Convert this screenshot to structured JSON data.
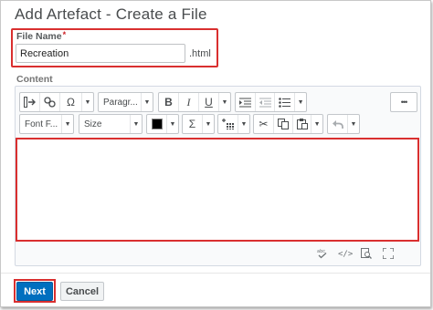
{
  "dialog": {
    "title": "Add Artefact - Create a File"
  },
  "file_name": {
    "label": "File Name",
    "required_marker": "*",
    "value": "Recreation",
    "suffix": ".html"
  },
  "content": {
    "label": "Content"
  },
  "toolbar": {
    "paragraph_select": "Paragr...",
    "font_family_select": "Font F...",
    "size_select": "Size",
    "bold": "B",
    "italic": "I",
    "underline": "U",
    "more": "•••",
    "sigma": "Σ",
    "text_color": "#000000"
  },
  "actions": {
    "next_label": "Next",
    "cancel_label": "Cancel"
  },
  "colors": {
    "primary": "#006fbf",
    "highlight": "#d92f2f"
  }
}
